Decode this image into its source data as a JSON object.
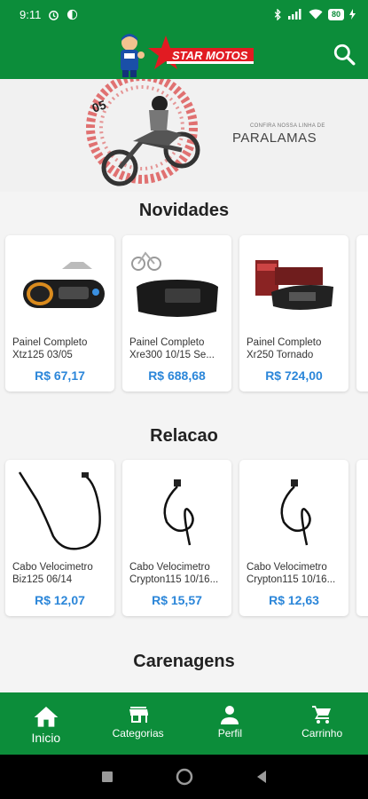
{
  "status_bar": {
    "time": "9:11",
    "battery": "80"
  },
  "header": {
    "brand": "STAR MOTOS",
    "search_icon": "search-icon"
  },
  "banner": {
    "small_text": "CONFIRA NOSSA LINHA DE",
    "big_text": "PARALAMAS"
  },
  "sections": [
    {
      "title": "Novidades",
      "products": [
        {
          "name": "Painel Completo Xtz125 03/05",
          "price": "R$ 67,17"
        },
        {
          "name": "Painel Completo Xre300 10/15 Se...",
          "price": "R$ 688,68"
        },
        {
          "name": "Painel Completo Xr250 Tornado",
          "price": "R$ 724,00"
        }
      ]
    },
    {
      "title": "Relacao",
      "products": [
        {
          "name": "Cabo Velocimetro Biz125 06/14",
          "price": "R$ 12,07"
        },
        {
          "name": "Cabo Velocimetro Crypton115 10/16...",
          "price": "R$ 15,57"
        },
        {
          "name": "Cabo Velocimetro Crypton115 10/16...",
          "price": "R$ 12,63"
        }
      ]
    },
    {
      "title": "Carenagens"
    }
  ],
  "bottom_nav": {
    "items": [
      {
        "label": "Inicio",
        "icon": "home-icon",
        "active": true
      },
      {
        "label": "Categorias",
        "icon": "store-icon"
      },
      {
        "label": "Perfil",
        "icon": "person-icon"
      },
      {
        "label": "Carrinho",
        "icon": "cart-icon"
      }
    ]
  },
  "colors": {
    "primary": "#0c8d3a",
    "price": "#2b86d9",
    "red": "#e11b22"
  }
}
